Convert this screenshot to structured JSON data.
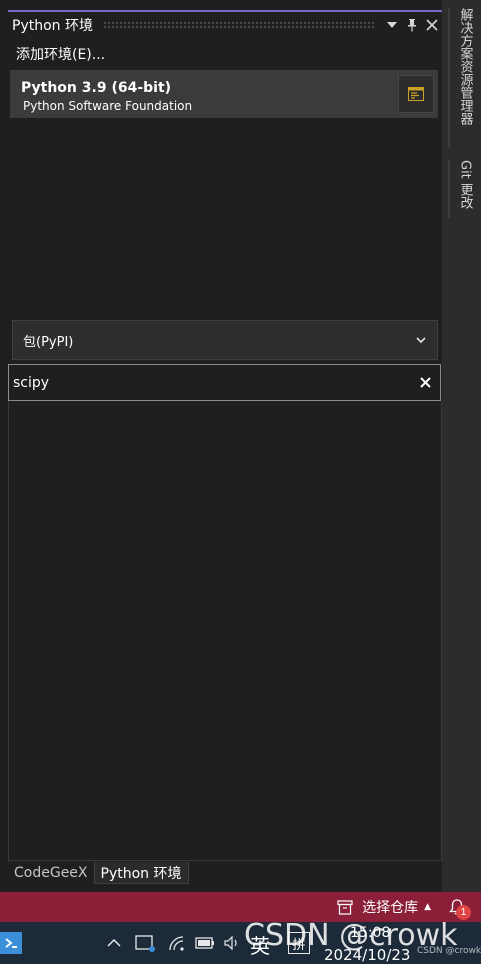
{
  "panel": {
    "title": "Python 环境",
    "title_buttons": [
      "dropdown-icon",
      "pin-icon",
      "close-icon"
    ],
    "add_environment_label": "添加环境(E)...",
    "environment": {
      "name": "Python 3.9 (64-bit)",
      "vendor": "Python Software Foundation",
      "open_icon": "console-icon"
    },
    "package_source": {
      "selected": "包(PyPI)"
    },
    "search": {
      "value": "scipy",
      "clear_icon": "clear-icon"
    }
  },
  "bottom_tabs": [
    {
      "label": "CodeGeeX",
      "active": false
    },
    {
      "label": "Python 环境",
      "active": true
    }
  ],
  "side_tabs": [
    {
      "label": "解决方案资源管理器"
    },
    {
      "label": "Git 更改"
    }
  ],
  "status_bar": {
    "repo_label": "选择仓库",
    "notification_count": "1",
    "background": "#8b1f37"
  },
  "taskbar": {
    "input_language": "英",
    "ime_mode": "拼",
    "time": "15:08",
    "date": "2024/10/23"
  },
  "watermark": {
    "large": "CSDN @crowk",
    "small": "CSDN @crowk"
  },
  "colors": {
    "accent": "#7a69c9",
    "panel_bg": "#1f1f1f",
    "selected_item_bg": "#3b3b3b"
  }
}
